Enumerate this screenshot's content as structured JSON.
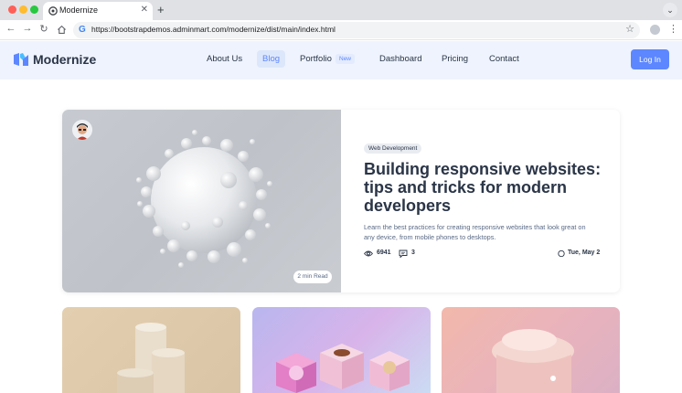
{
  "browser": {
    "tab_title": "Modernize",
    "new_tab": "+",
    "close": "✕",
    "url": "https://bootstrapdemos.adminmart.com/modernize/dist/main/index.html"
  },
  "site": {
    "brand": "Modernize",
    "nav": [
      {
        "label": "About Us"
      },
      {
        "label": "Blog",
        "active": true
      },
      {
        "label": "Portfolio"
      },
      {
        "label": "Dashboard"
      },
      {
        "label": "Pricing"
      },
      {
        "label": "Contact"
      }
    ],
    "new_badge": "New",
    "login": "Log In",
    "accent": "#5d87ff"
  },
  "featured_post": {
    "read_time": "2 min Read",
    "category": "Web Development",
    "title": "Building responsive websites: tips and tricks for modern developers",
    "description": "Learn the best practices for creating responsive websites that look great on any device, from mobile phones to desktops.",
    "views": "6941",
    "comments": "3",
    "date": "Tue, May 2"
  }
}
